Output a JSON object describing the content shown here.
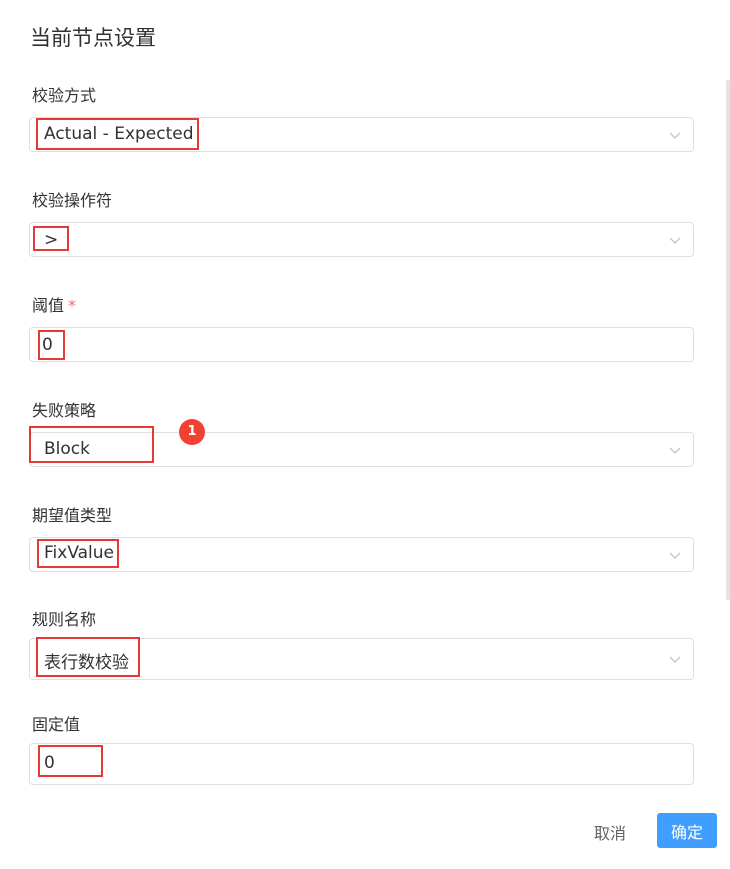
{
  "dialog": {
    "title": "当前节点设置"
  },
  "fields": {
    "check_method": {
      "label": "校验方式",
      "value": "Actual - Expected"
    },
    "operator": {
      "label": "校验操作符",
      "value": ">"
    },
    "threshold": {
      "label": "阈值",
      "required_mark": "*",
      "value": "0"
    },
    "failure_strategy": {
      "label": "失败策略",
      "value": "Block"
    },
    "expected_type": {
      "label": "期望值类型",
      "value": "FixValue"
    },
    "rule_name": {
      "label": "规则名称",
      "value": "表行数校验"
    },
    "fixed_value": {
      "label": "固定值",
      "value": "0"
    }
  },
  "annotation": {
    "badge": "1"
  },
  "footer": {
    "cancel_label": "取消",
    "confirm_label": "确定"
  },
  "colors": {
    "highlight": "#e53935",
    "primary": "#409eff",
    "badge": "#f04134",
    "required": "#f56c6c"
  }
}
